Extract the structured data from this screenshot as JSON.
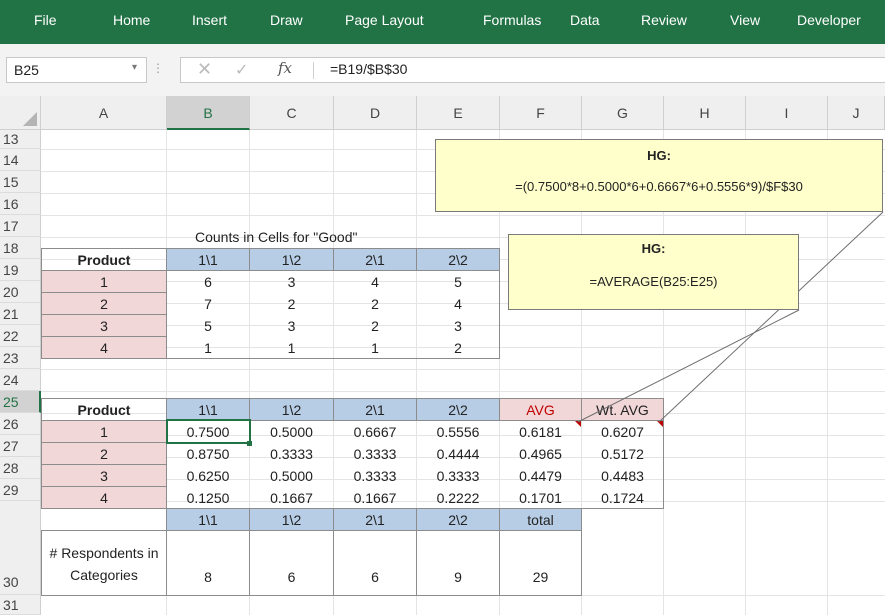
{
  "ribbon": {
    "tabs": [
      "File",
      "Home",
      "Insert",
      "Draw",
      "Page Layout",
      "Formulas",
      "Data",
      "Review",
      "View",
      "Developer"
    ],
    "accent": "#217346"
  },
  "formula_bar": {
    "name_box": "B25",
    "formula": "=B19/$B$30",
    "cancel_icon": "x-icon",
    "enter_icon": "check-icon",
    "fx_label": "fx"
  },
  "columns": [
    "A",
    "B",
    "C",
    "D",
    "E",
    "F",
    "G",
    "H",
    "I",
    "J"
  ],
  "rows": [
    "13",
    "14",
    "15",
    "16",
    "17",
    "18",
    "19",
    "20",
    "21",
    "22",
    "23",
    "24",
    "25",
    "26",
    "27",
    "28",
    "29",
    "30",
    "31"
  ],
  "table1": {
    "title": "Counts in Cells for \"Good\"",
    "header": [
      "Product",
      "1\\1",
      "1\\2",
      "2\\1",
      "2\\2"
    ],
    "rows": [
      [
        "1",
        "6",
        "3",
        "4",
        "5"
      ],
      [
        "2",
        "7",
        "2",
        "2",
        "4"
      ],
      [
        "3",
        "5",
        "3",
        "2",
        "3"
      ],
      [
        "4",
        "1",
        "1",
        "1",
        "2"
      ]
    ]
  },
  "table2": {
    "header": [
      "Product",
      "1\\1",
      "1\\2",
      "2\\1",
      "2\\2",
      "AVG",
      "Wt. AVG"
    ],
    "rows": [
      [
        "1",
        "0.7500",
        "0.5000",
        "0.6667",
        "0.5556",
        "0.6181",
        "0.6207"
      ],
      [
        "2",
        "0.8750",
        "0.3333",
        "0.3333",
        "0.4444",
        "0.4965",
        "0.5172"
      ],
      [
        "3",
        "0.6250",
        "0.5000",
        "0.3333",
        "0.3333",
        "0.4479",
        "0.4483"
      ],
      [
        "4",
        "0.1250",
        "0.1667",
        "0.1667",
        "0.2222",
        "0.1701",
        "0.1724"
      ]
    ]
  },
  "table3": {
    "header": [
      "1\\1",
      "1\\2",
      "2\\1",
      "2\\2",
      "total"
    ],
    "label": "# Respondents in Categories",
    "values": [
      "8",
      "6",
      "6",
      "9",
      "29"
    ]
  },
  "notes": [
    {
      "title": "HG:",
      "text": "=(0.7500*8+0.5000*6+0.6667*6+0.5556*9)/$F$30"
    },
    {
      "title": "HG:",
      "text": "=AVERAGE(B25:E25)"
    }
  ],
  "colors": {
    "pink": "#f2d7d9",
    "blue": "#b7cde6",
    "note": "#ffffcc",
    "red_text": "#c00000"
  }
}
